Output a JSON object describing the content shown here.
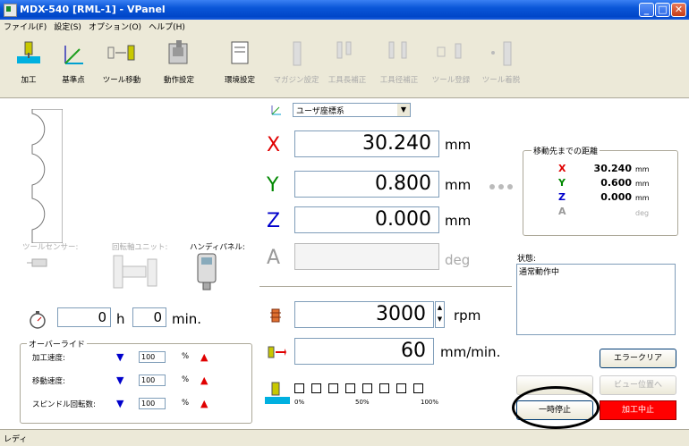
{
  "window": {
    "title": "MDX-540  [RML-1] - VPanel"
  },
  "menu": [
    "ファイル(F)",
    "設定(S)",
    "オプション(O)",
    "ヘルプ(H)"
  ],
  "toolbar": {
    "items": [
      {
        "label": "加工",
        "enabled": true
      },
      {
        "label": "基準点",
        "enabled": true
      },
      {
        "label": "ツール移動",
        "enabled": true
      },
      {
        "label": "動作設定",
        "enabled": true
      },
      {
        "label": "環境設定",
        "enabled": true
      },
      {
        "label": "マガジン設定",
        "enabled": false
      },
      {
        "label": "工具長補正",
        "enabled": false
      },
      {
        "label": "工具径補正",
        "enabled": false
      },
      {
        "label": "ツール登録",
        "enabled": false
      },
      {
        "label": "ツール着脱",
        "enabled": false
      }
    ]
  },
  "coord_system": {
    "selected": "ユーザ座標系"
  },
  "coords": {
    "x": {
      "label": "X",
      "value": "30.240",
      "unit": "mm"
    },
    "y": {
      "label": "Y",
      "value": "0.800",
      "unit": "mm"
    },
    "z": {
      "label": "Z",
      "value": "0.000",
      "unit": "mm"
    },
    "a": {
      "label": "A",
      "value": "",
      "unit": "deg"
    }
  },
  "distance_panel": {
    "title": "移動先までの距離",
    "rows": [
      {
        "axis": "X",
        "value": "30.240",
        "unit": "mm"
      },
      {
        "axis": "Y",
        "value": "0.600",
        "unit": "mm"
      },
      {
        "axis": "Z",
        "value": "0.000",
        "unit": "mm"
      },
      {
        "axis": "A",
        "value": "",
        "unit": "deg"
      }
    ]
  },
  "peripherals": {
    "tool_sensor": "ツールセンサー:",
    "rotary_unit": "回転軸ユニット:",
    "handy_panel": "ハンディパネル:"
  },
  "timer": {
    "hours": "0",
    "h_unit": "h",
    "minutes": "0",
    "min_unit": "min."
  },
  "override": {
    "title": "オーバーライド",
    "rows": [
      {
        "label": "加工速度:",
        "value": "100",
        "unit": "%"
      },
      {
        "label": "移動速度:",
        "value": "100",
        "unit": "%"
      },
      {
        "label": "スピンドル回転数:",
        "value": "100",
        "unit": "%"
      }
    ]
  },
  "spindle": {
    "value": "3000",
    "unit": "rpm"
  },
  "feed": {
    "value": "60",
    "unit": "mm/min."
  },
  "load": {
    "ticks": [
      "0%",
      "50%",
      "100%"
    ],
    "segments": 8,
    "level": 0
  },
  "state": {
    "label": "状態:",
    "text": "通常動作中"
  },
  "buttons": {
    "error_clear": "エラークリア",
    "view_position": "ビュー位置へ",
    "hidden_left": "",
    "pause": "一時停止",
    "stop": "加工中止"
  },
  "status_bar": "レディ",
  "colors": {
    "x": "#e00000",
    "y": "#008800",
    "z": "#0000cc",
    "a": "#999999",
    "stop": "#ff0000",
    "highlight": "#000000"
  }
}
